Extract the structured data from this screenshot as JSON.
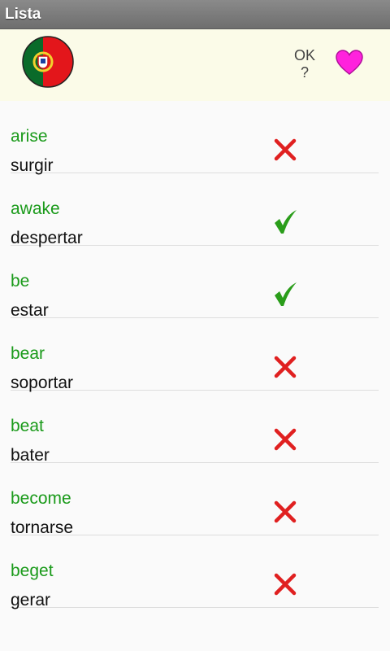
{
  "app": {
    "title": "Lista"
  },
  "header": {
    "ok_label": "OK",
    "ok_sub": "?"
  },
  "colors": {
    "english": "#1a9a1a",
    "correct": "#2a9d1a",
    "wrong": "#e02020",
    "heart": "#ff22dd"
  },
  "items": [
    {
      "en": "arise",
      "es": "surgir",
      "status": "wrong"
    },
    {
      "en": "awake",
      "es": "despertar",
      "status": "correct"
    },
    {
      "en": "be",
      "es": "estar",
      "status": "correct"
    },
    {
      "en": "bear",
      "es": "soportar",
      "status": "wrong"
    },
    {
      "en": "beat",
      "es": "bater",
      "status": "wrong"
    },
    {
      "en": "become",
      "es": "tornarse",
      "status": "wrong"
    },
    {
      "en": "beget",
      "es": "gerar",
      "status": "wrong"
    }
  ]
}
